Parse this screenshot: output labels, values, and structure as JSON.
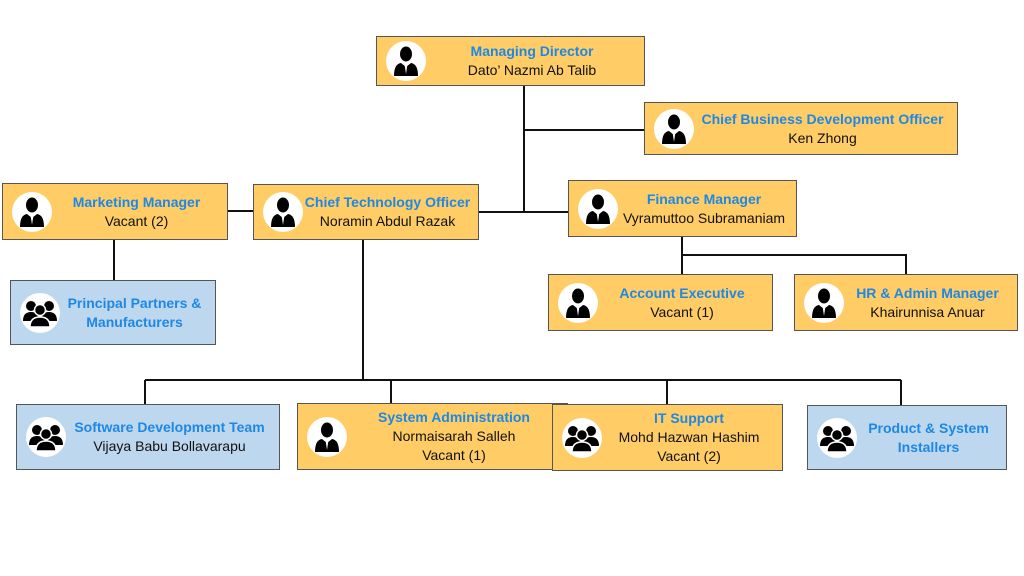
{
  "colors": {
    "role_box": "#FFCC66",
    "team_box": "#BDD7EE",
    "title_text": "#1E88E5"
  },
  "nodes": {
    "md": {
      "title": "Managing Director",
      "lines": [
        "Dato’ Nazmi Ab Talib"
      ],
      "icon": "person-icon"
    },
    "cbdo": {
      "title": "Chief Business Development Officer",
      "lines": [
        "Ken Zhong"
      ],
      "icon": "person-icon"
    },
    "marketing": {
      "title": "Marketing Manager",
      "lines": [
        "Vacant (2)"
      ],
      "icon": "person-icon"
    },
    "cto": {
      "title": "Chief Technology Officer",
      "lines": [
        "Noramin Abdul Razak"
      ],
      "icon": "person-icon"
    },
    "finance": {
      "title": "Finance Manager",
      "lines": [
        "Vyramuttoo Subramaniam"
      ],
      "icon": "person-icon"
    },
    "partners": {
      "title": "Principal Partners & Manufacturers",
      "lines": [],
      "icon": "group-icon"
    },
    "account": {
      "title": "Account Executive",
      "lines": [
        "Vacant (1)"
      ],
      "icon": "person-icon"
    },
    "hr": {
      "title": "HR & Admin Manager",
      "lines": [
        "Khairunnisa Anuar"
      ],
      "icon": "person-icon"
    },
    "swdev": {
      "title": "Software Development Team",
      "lines": [
        "Vijaya Babu Bollavarapu"
      ],
      "icon": "group-icon"
    },
    "sysadmin": {
      "title": "System Administration",
      "lines": [
        "Normaisarah Salleh",
        "Vacant (1)"
      ],
      "icon": "person-icon"
    },
    "itsupport": {
      "title": "IT Support",
      "lines": [
        "Mohd Hazwan Hashim",
        "Vacant (2)"
      ],
      "icon": "group-icon"
    },
    "installers": {
      "title": "Product & System Installers",
      "lines": [],
      "icon": "group-icon"
    }
  }
}
